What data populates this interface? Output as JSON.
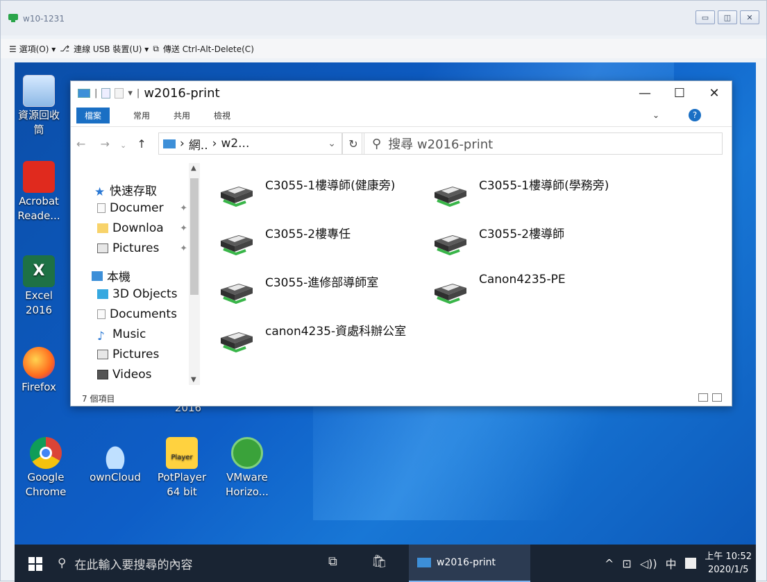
{
  "vm": {
    "title": "w10-1231",
    "menu": {
      "options": "☰ 選項(O) ▾",
      "usb": "連線 USB 裝置(U) ▾",
      "send": "傳送 Ctrl-Alt-Delete(C)"
    },
    "window_buttons": [
      "▭",
      "◫",
      "✕"
    ]
  },
  "desktop_icons": [
    {
      "label": "資源回收\n筒",
      "icon": "recycle-bin-icon"
    },
    {
      "label": "Acrobat\nReade...",
      "icon": "acrobat-icon"
    },
    {
      "label": "Excel\n2016",
      "icon": "excel-icon"
    },
    {
      "label": "Firefox",
      "icon": "firefox-icon"
    },
    {
      "label": "Google\nChrome",
      "icon": "chrome-icon"
    },
    {
      "label": "ownCloud",
      "icon": "owncloud-icon"
    },
    {
      "label": "PotPlayer\n64 bit",
      "icon": "potplayer-icon"
    },
    {
      "label": "VMware\nHorizo...",
      "icon": "vmware-icon"
    },
    {
      "label": "2016",
      "icon": ""
    }
  ],
  "explorer": {
    "title": "w2016-print",
    "ribbon_tabs": [
      "檔案",
      "常用",
      "共用",
      "檢視"
    ],
    "breadcrumb": {
      "part1": "網..",
      "part2": "w2..."
    },
    "search_placeholder": "搜尋 w2016-print",
    "nav": {
      "quick_access": "快速存取",
      "qa_items": [
        "Documer",
        "Downloa",
        "Pictures"
      ],
      "this_pc": "本機",
      "pc_items": [
        "3D Objects",
        "Documents",
        "Music",
        "Pictures",
        "Videos"
      ]
    },
    "printers": [
      "C3055-1樓導師(健康旁)",
      "C3055-1樓導師(學務旁)",
      "C3055-2樓專任",
      "C3055-2樓導師",
      "C3055-進修部導師室",
      "Canon4235-PE",
      "canon4235-資處科辦公室"
    ],
    "status": "7 個項目"
  },
  "taskbar": {
    "search": "在此輸入要搜尋的內容",
    "app": "w2016-print",
    "tray": [
      "^",
      "⊡",
      "◁))",
      "中"
    ],
    "time": "上午 10:52",
    "date": "2020/1/5"
  },
  "colors": {
    "accent": "#1a6fc4",
    "taskbar": "#192433",
    "desktop": "#0e5ec7"
  }
}
